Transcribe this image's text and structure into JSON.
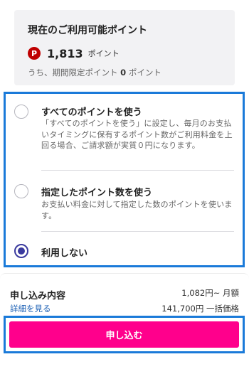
{
  "points": {
    "title": "現在のご利用可能ポイント",
    "icon": "rakuten-point-icon",
    "icon_letter": "P",
    "value": "1,813",
    "unit": "ポイント",
    "note_prefix": "うち、期間限定ポイント",
    "note_value": "0",
    "note_suffix": "ポイント"
  },
  "options": [
    {
      "label": "すべてのポイントを使う",
      "description": "「すべてのポイントを使う」に設定し、毎月のお支払いタイミングに保有するポイント数がご利用料金を上回る場合、ご請求額が実質０円になります。",
      "selected": false
    },
    {
      "label": "指定したポイント数を使う",
      "description": "お支払い料金に対して指定した数のポイントを使います。",
      "selected": false
    },
    {
      "label": "利用しない",
      "description": "",
      "selected": true
    }
  ],
  "summary": {
    "title": "申し込み内容",
    "details_link": "詳細を見る",
    "monthly_price": "1,082円~ 月額",
    "lump_price": "141,700円 一括価格"
  },
  "apply_label": "申し込む",
  "colors": {
    "accent": "#ff008c",
    "highlight_border": "#1a7ad9",
    "radio_selected": "#3a3a9e",
    "point_badge": "#bf0000"
  }
}
